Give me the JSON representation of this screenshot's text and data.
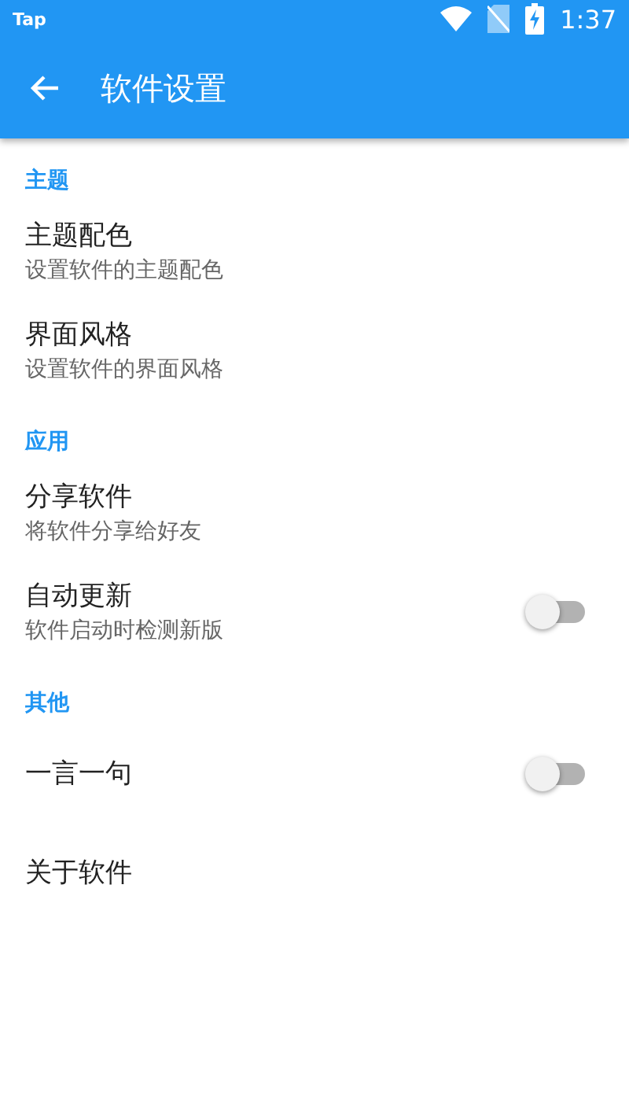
{
  "status_bar": {
    "app": "Tap",
    "time": "1:37"
  },
  "toolbar": {
    "title": "软件设置"
  },
  "sections": [
    {
      "header": "主题",
      "items": [
        {
          "kind": "link",
          "title": "主题配色",
          "subtitle": "设置软件的主题配色"
        },
        {
          "kind": "link",
          "title": "界面风格",
          "subtitle": "设置软件的界面风格"
        }
      ]
    },
    {
      "header": "应用",
      "items": [
        {
          "kind": "link",
          "title": "分享软件",
          "subtitle": "将软件分享给好友"
        },
        {
          "kind": "switch",
          "title": "自动更新",
          "subtitle": "软件启动时检测新版",
          "on": false
        }
      ]
    },
    {
      "header": "其他",
      "items": [
        {
          "kind": "switch",
          "title": "一言一句",
          "on": false
        },
        {
          "kind": "link",
          "title": "关于软件"
        }
      ]
    }
  ]
}
